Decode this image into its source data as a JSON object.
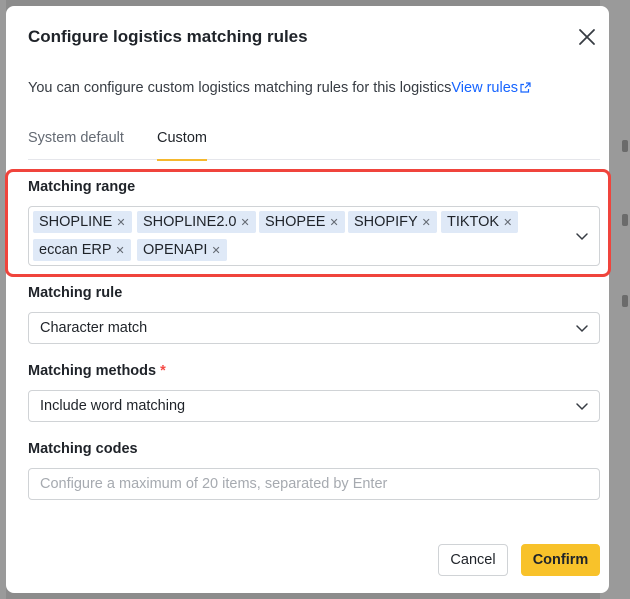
{
  "modal": {
    "title": "Configure logistics matching rules",
    "description": "You can configure custom logistics matching rules for this logistics",
    "view_rules_link": "View rules"
  },
  "tabs": [
    {
      "label": "System default",
      "active": false
    },
    {
      "label": "Custom",
      "active": true
    }
  ],
  "matching_range": {
    "label": "Matching range",
    "tags": [
      "SHOPLINE",
      "SHOPLINE2.0",
      "SHOPEE",
      "SHOPIFY",
      "TIKTOK",
      "eccan ERP",
      "OPENAPI"
    ]
  },
  "matching_rule": {
    "label": "Matching rule",
    "value": "Character match"
  },
  "matching_methods": {
    "label": "Matching methods",
    "required_mark": "*",
    "value": "Include word matching"
  },
  "matching_codes": {
    "label": "Matching codes",
    "placeholder": "Configure a maximum of 20 items, separated by Enter",
    "value": ""
  },
  "footer": {
    "cancel_label": "Cancel",
    "confirm_label": "Confirm"
  },
  "colors": {
    "accent": "#f8c22a",
    "link": "#1664ff",
    "highlight": "#f0443c",
    "tag_bg": "#dfe9f7"
  }
}
